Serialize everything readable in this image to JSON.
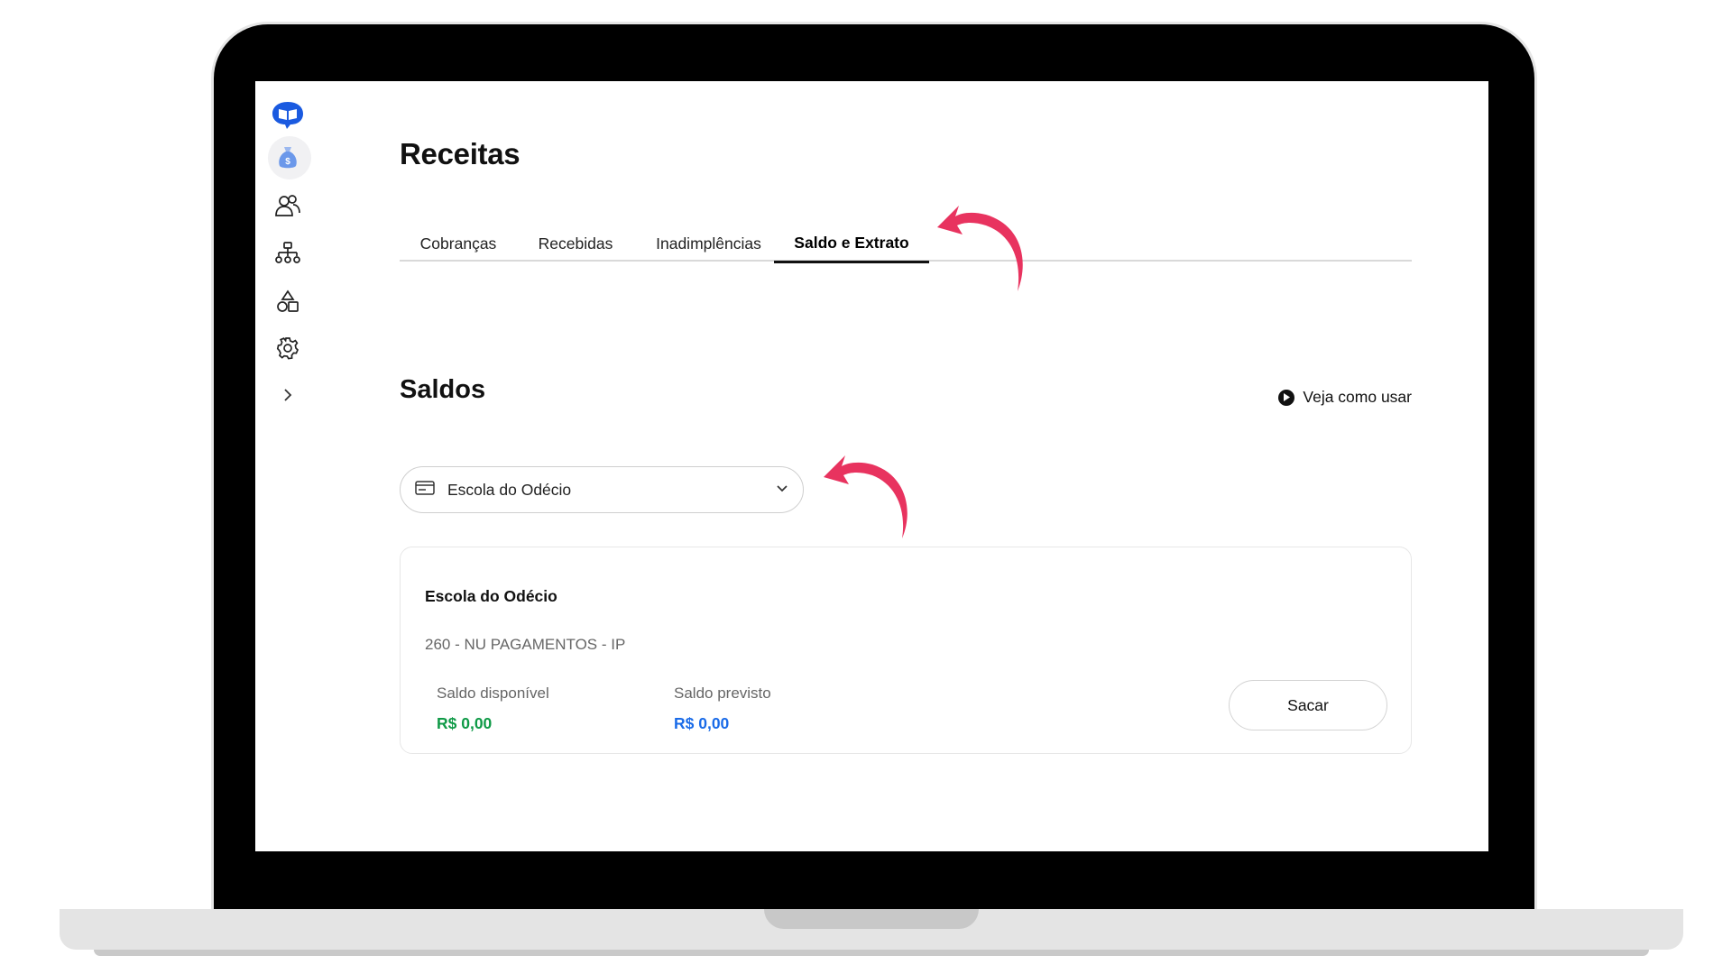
{
  "page": {
    "title": "Receitas"
  },
  "tabs": [
    {
      "label": "Cobranças",
      "active": false
    },
    {
      "label": "Recebidas",
      "active": false
    },
    {
      "label": "Inadimplências",
      "active": false
    },
    {
      "label": "Saldo e Extrato",
      "active": true
    }
  ],
  "section": {
    "title": "Saldos",
    "help_link": "Veja como usar"
  },
  "account_select": {
    "value": "Escola do Odécio"
  },
  "card": {
    "name": "Escola do Odécio",
    "bank": "260 - NU PAGAMENTOS - IP",
    "available_label": "Saldo disponível",
    "available_value": "R$ 0,00",
    "forecast_label": "Saldo previsto",
    "forecast_value": "R$ 0,00",
    "withdraw_label": "Sacar"
  },
  "sidebar": {
    "items": [
      {
        "icon": "book-chat-logo-icon"
      },
      {
        "icon": "money-bag-icon",
        "active": true
      },
      {
        "icon": "users-icon"
      },
      {
        "icon": "org-chart-icon"
      },
      {
        "icon": "shapes-icon"
      },
      {
        "icon": "gear-icon"
      },
      {
        "icon": "chevron-right-icon"
      }
    ]
  },
  "colors": {
    "accent_blue": "#1a5ae0",
    "available_green": "#0f9a47",
    "forecast_blue": "#1a6be8",
    "annotation_pink": "#e8335f"
  }
}
